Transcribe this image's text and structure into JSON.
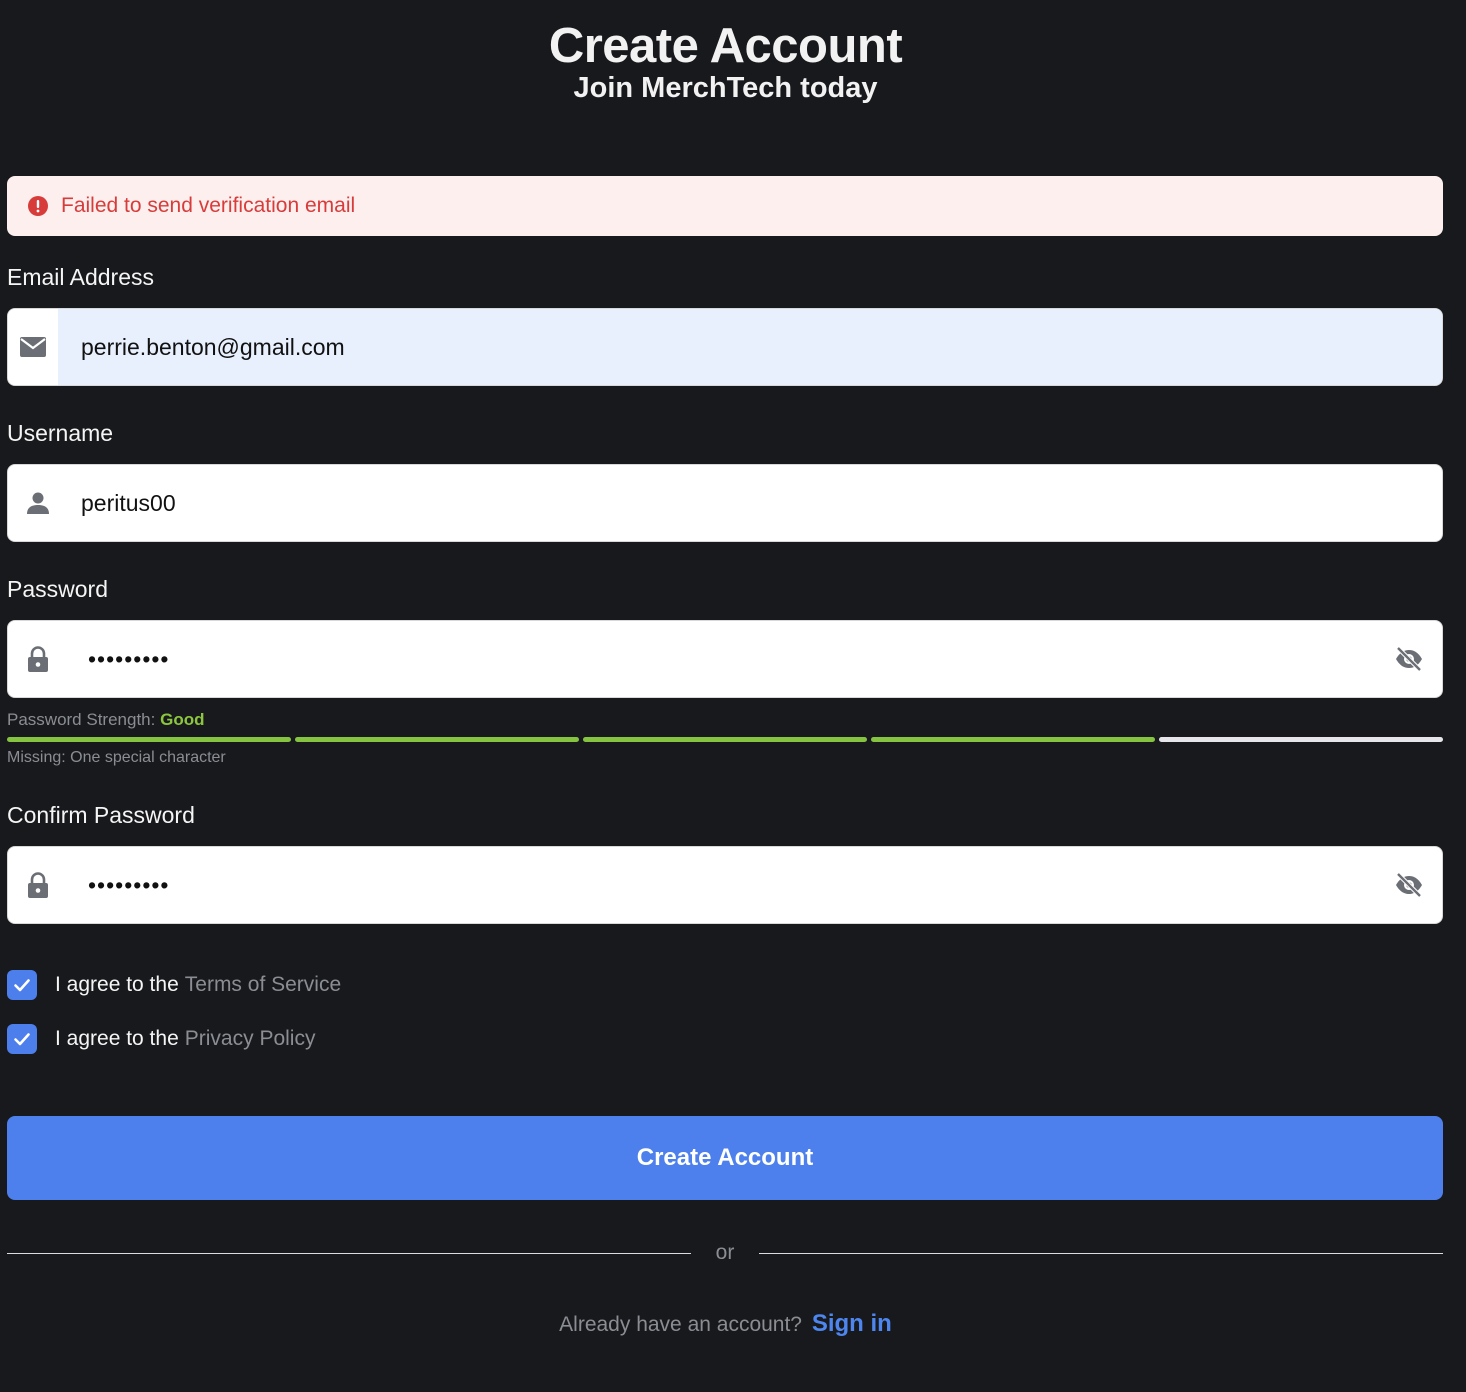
{
  "header": {
    "title": "Create Account",
    "subtitle": "Join MerchTech today"
  },
  "alert": {
    "message": "Failed to send verification email",
    "icon": "error-circle-icon",
    "color": "#d73c3b"
  },
  "email": {
    "label": "Email Address",
    "value": "perrie.benton@gmail.com",
    "icon": "mail-icon"
  },
  "username": {
    "label": "Username",
    "value": "peritus00",
    "icon": "person-icon"
  },
  "password": {
    "label": "Password",
    "masked": "•••••••••",
    "icon": "lock-icon",
    "toggle_icon": "eye-off-icon",
    "strength_prefix": "Password Strength:",
    "strength_value": "Good",
    "strength_level": 0.8,
    "strength_color": "#85c441",
    "missing": "Missing: One special character"
  },
  "confirm_password": {
    "label": "Confirm Password",
    "masked": "•••••••••",
    "icon": "lock-icon",
    "toggle_icon": "eye-off-icon"
  },
  "agreements": {
    "terms_prefix": "I agree to the",
    "terms_link": "Terms of Service",
    "terms_checked": true,
    "privacy_prefix": "I agree to the",
    "privacy_link": "Privacy Policy",
    "privacy_checked": true
  },
  "submit": {
    "label": "Create Account",
    "color": "#4d80ec"
  },
  "divider": {
    "text": "or"
  },
  "footer": {
    "prompt": "Already have an account?",
    "link": "Sign in"
  }
}
